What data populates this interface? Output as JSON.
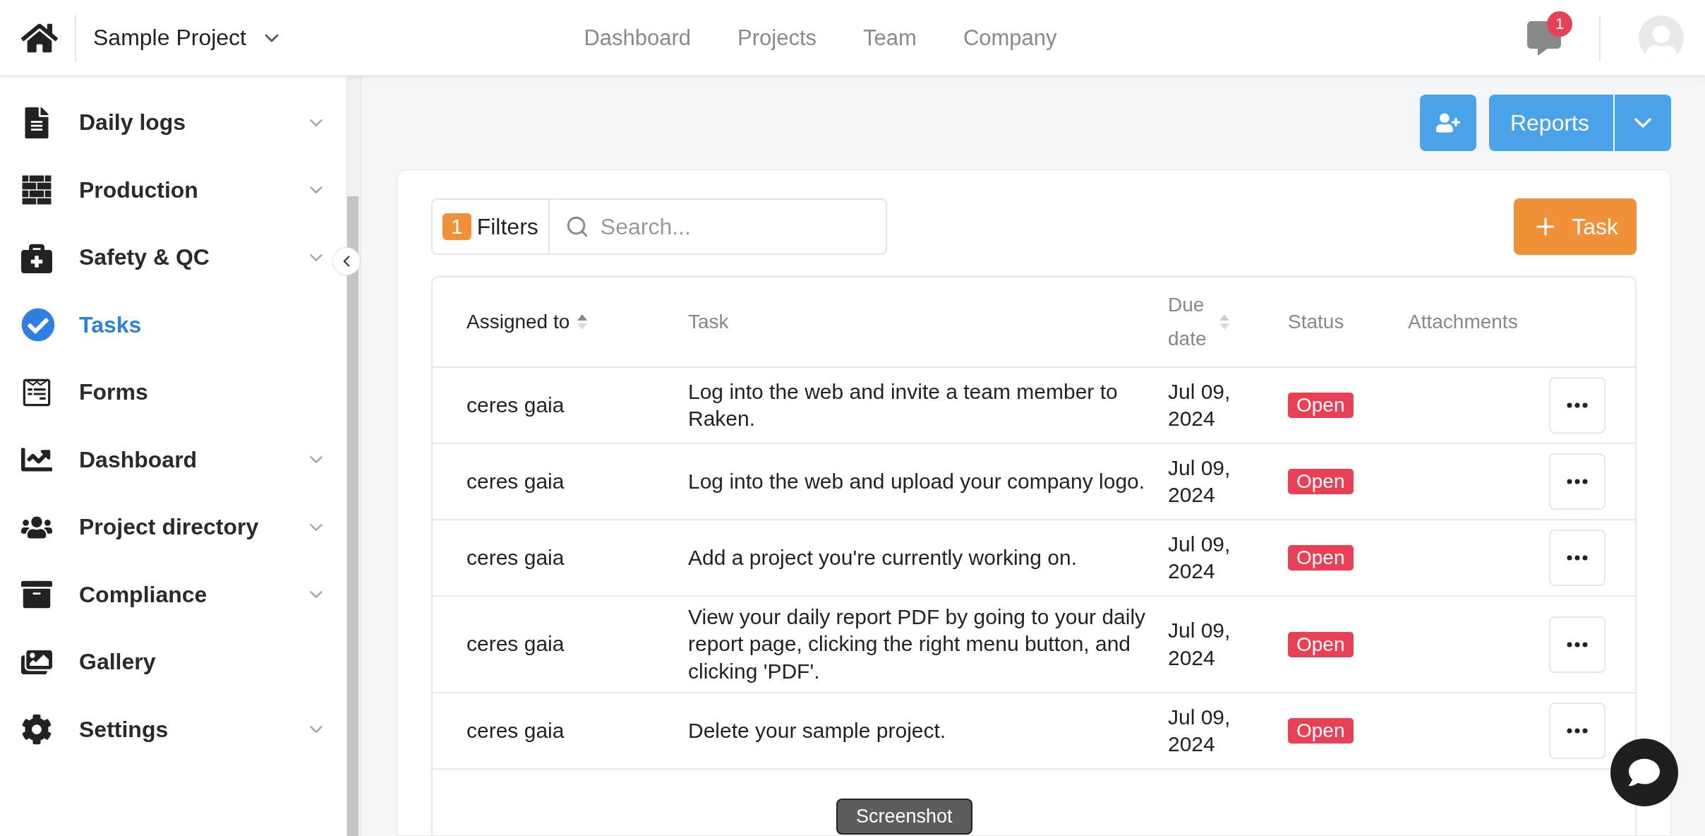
{
  "header": {
    "project": "Sample Project",
    "nav": [
      {
        "label": "Dashboard",
        "selected": false
      },
      {
        "label": "Projects",
        "selected": false
      },
      {
        "label": "Team",
        "selected": false
      },
      {
        "label": "Company",
        "selected": false
      }
    ],
    "notifications": "1"
  },
  "sidebar": {
    "items": [
      {
        "label": "Daily logs",
        "selected": false,
        "expandable": true
      },
      {
        "label": "Production",
        "selected": false,
        "expandable": true
      },
      {
        "label": "Safety & QC",
        "selected": false,
        "expandable": true
      },
      {
        "label": "Tasks",
        "selected": true,
        "expandable": false
      },
      {
        "label": "Forms",
        "selected": false,
        "expandable": false
      },
      {
        "label": "Dashboard",
        "selected": false,
        "expandable": true
      },
      {
        "label": "Project directory",
        "selected": false,
        "expandable": true
      },
      {
        "label": "Compliance",
        "selected": false,
        "expandable": true
      },
      {
        "label": "Gallery",
        "selected": false,
        "expandable": false
      },
      {
        "label": "Settings",
        "selected": false,
        "expandable": true
      }
    ]
  },
  "toolbar": {
    "reports": "Reports"
  },
  "filters": {
    "count": "1",
    "label": "Filters"
  },
  "search": {
    "placeholder": "Search..."
  },
  "add_button": "Task",
  "table": {
    "columns": [
      {
        "label": "Assigned to",
        "sortable": true,
        "sorted": true
      },
      {
        "label": "Task",
        "sortable": false,
        "sorted": false
      },
      {
        "label": "Due date",
        "sortable": true,
        "sorted": false
      },
      {
        "label": "Status",
        "sortable": false,
        "sorted": false
      },
      {
        "label": "Attachments",
        "sortable": false,
        "sorted": false
      }
    ],
    "rows": [
      {
        "assigned": "ceres gaia",
        "task": "Log into the web and invite a team member to Raken.",
        "due": "Jul 09, 2024",
        "status": "Open"
      },
      {
        "assigned": "ceres gaia",
        "task": "Log into the web and upload your company logo.",
        "due": "Jul 09, 2024",
        "status": "Open"
      },
      {
        "assigned": "ceres gaia",
        "task": "Add a project you're currently working on.",
        "due": "Jul 09, 2024",
        "status": "Open"
      },
      {
        "assigned": "ceres gaia",
        "task": "View your daily report PDF by going to your daily report page, clicking the right menu button, and clicking 'PDF'.",
        "due": "Jul 09, 2024",
        "status": "Open"
      },
      {
        "assigned": "ceres gaia",
        "task": "Delete your sample project.",
        "due": "Jul 09, 2024",
        "status": "Open"
      }
    ]
  },
  "tooltip": "Screenshot"
}
